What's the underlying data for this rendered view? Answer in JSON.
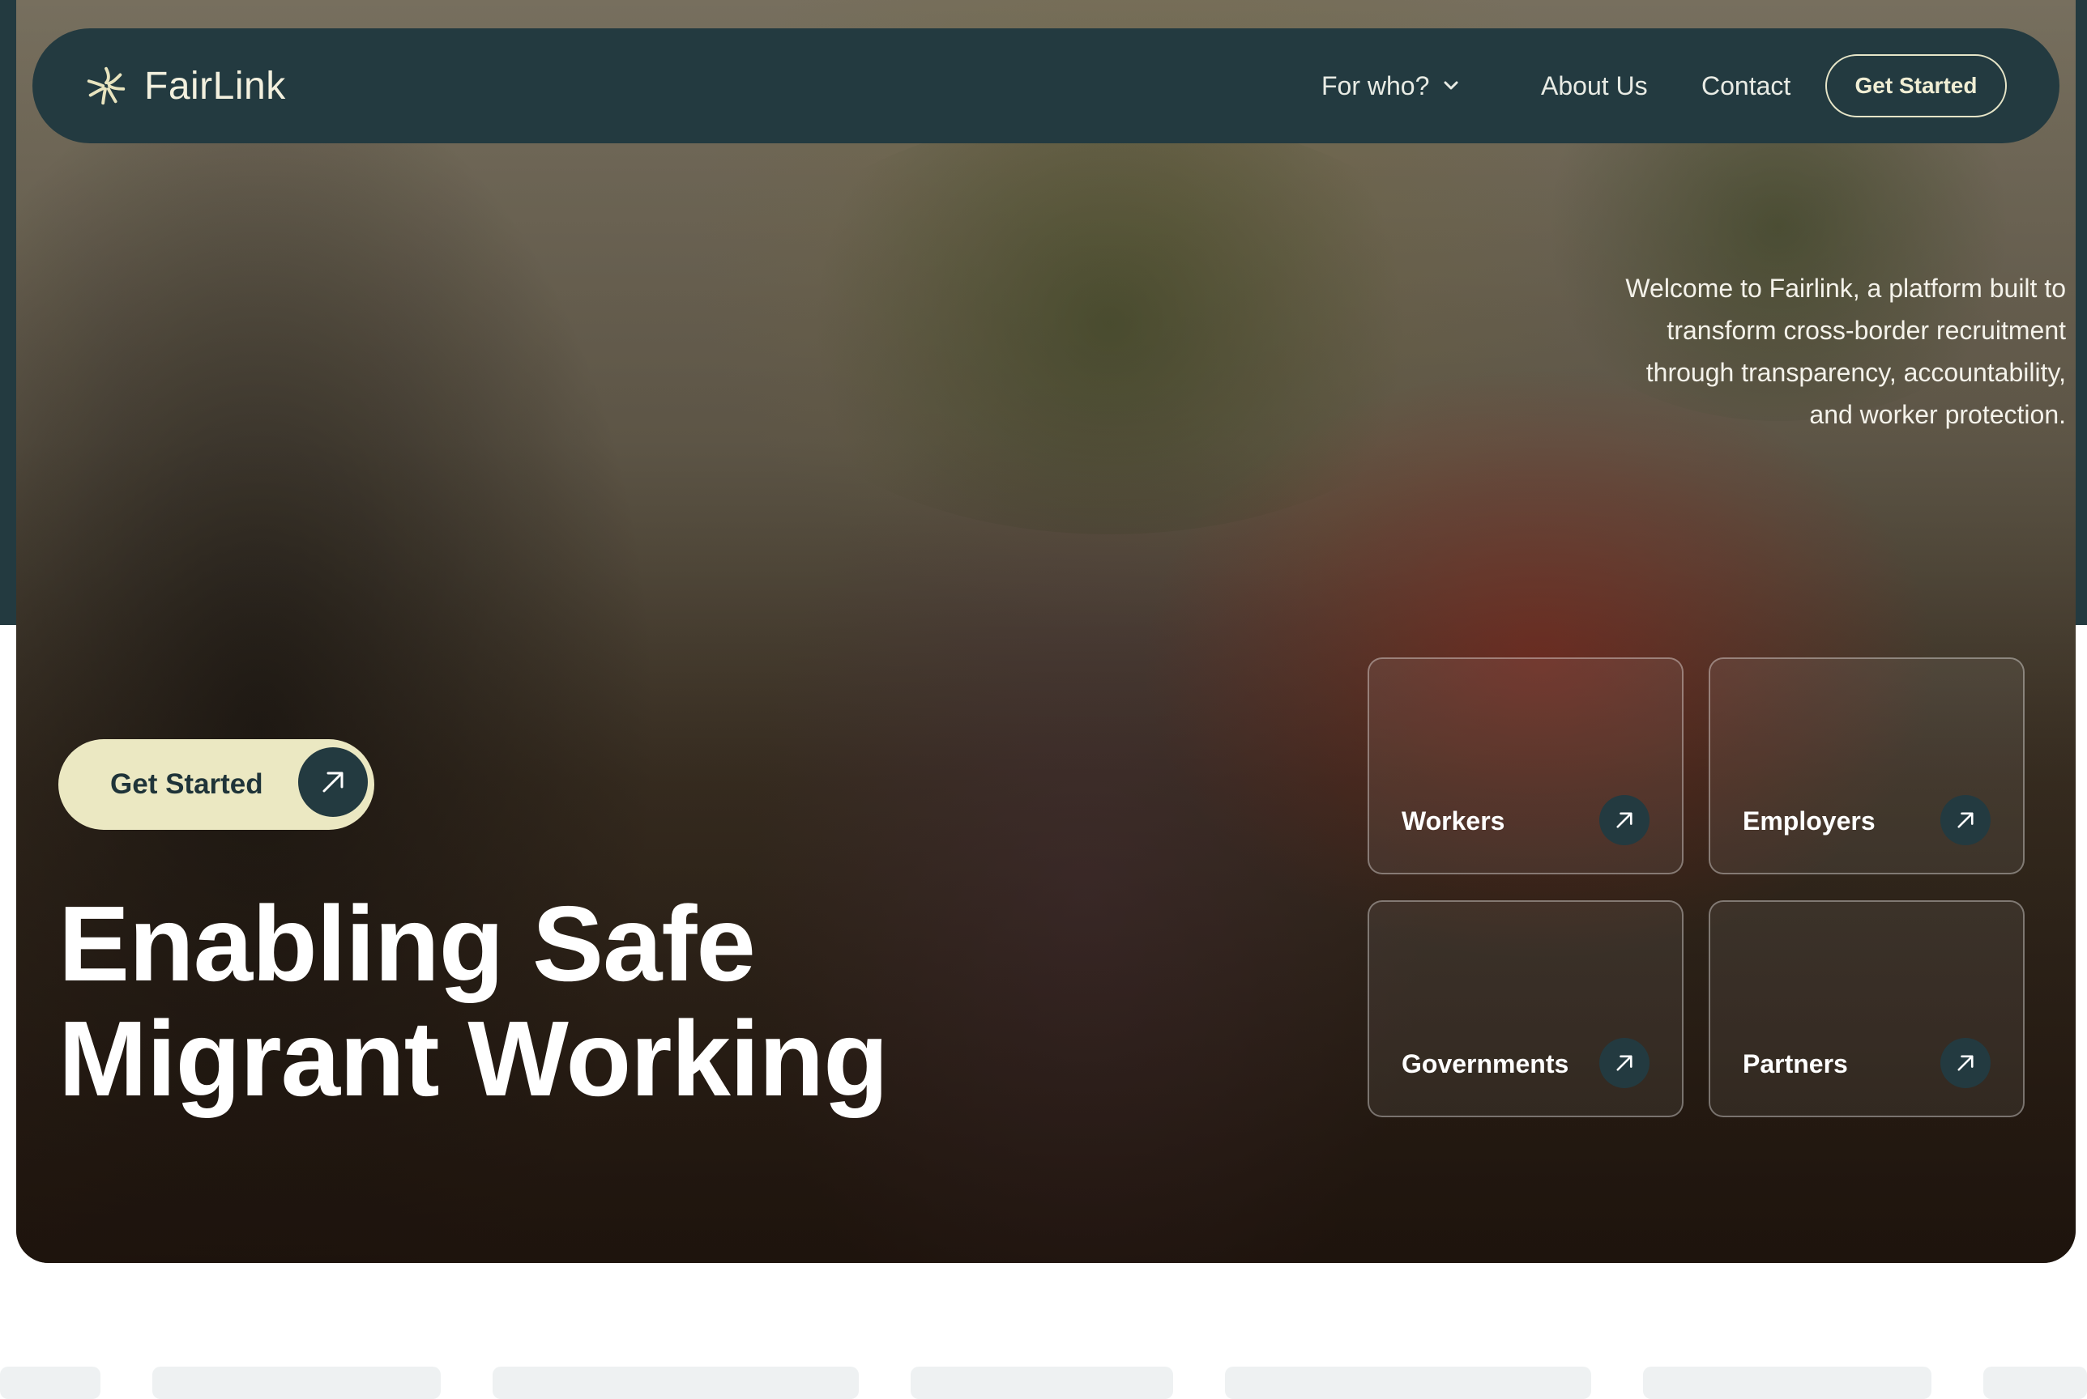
{
  "nav": {
    "brand": "FairLink",
    "items": [
      {
        "label": "For who?",
        "has_dropdown": true
      },
      {
        "label": "About Us"
      },
      {
        "label": "Contact"
      }
    ],
    "cta_label": "Get Started"
  },
  "hero": {
    "welcome_text": "Welcome to Fairlink, a platform built to transform cross-border recruitment through transparency, accountability, and worker protection.",
    "cta_label": "Get Started",
    "headline_line1": "Enabling Safe",
    "headline_line2": "Migrant Working",
    "cards": [
      {
        "label": "Workers"
      },
      {
        "label": "Employers"
      },
      {
        "label": "Governments"
      },
      {
        "label": "Partners"
      }
    ]
  },
  "icons": {
    "logo": "fairlink-logo-icon",
    "dropdown": "chevron-down-icon",
    "arrow": "arrow-up-right-icon"
  },
  "colors": {
    "nav_bg": "#233a40",
    "cta_bg": "#ebe8c2",
    "cta_text": "#1f3439",
    "brand_text": "#f3f0de"
  }
}
